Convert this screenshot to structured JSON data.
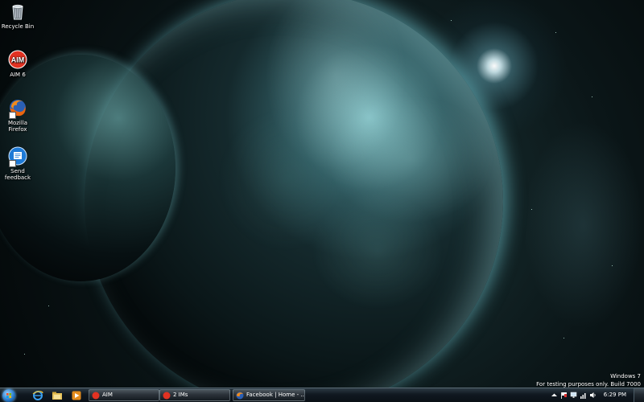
{
  "desktop": {
    "icons": [
      {
        "label": "Recycle Bin",
        "icon": "recycle-bin-icon"
      },
      {
        "label": "AIM 6",
        "icon": "aim-icon"
      },
      {
        "label": "Mozilla Firefox",
        "icon": "firefox-icon"
      },
      {
        "label": "Send feedback",
        "icon": "feedback-icon"
      }
    ],
    "watermark": {
      "line1": "Windows 7",
      "line2": "For testing purposes only. Build 7000"
    }
  },
  "taskbar": {
    "start_icon": "windows-start-orb-icon",
    "quick_launch": [
      {
        "icon": "internet-explorer-icon"
      },
      {
        "icon": "windows-explorer-icon"
      },
      {
        "icon": "media-player-icon"
      }
    ],
    "buttons": [
      {
        "label": "AIM",
        "icon": "aim-icon"
      },
      {
        "label": "2 IMs",
        "icon": "aim-icon"
      },
      {
        "label": "Facebook | Home - ...",
        "icon": "firefox-icon"
      }
    ],
    "tray": {
      "icons": [
        "show-hidden-icons-arrow-icon",
        "action-center-flag-icon",
        "network-icon",
        "signal-icon",
        "volume-icon"
      ],
      "time": "6:29 PM"
    }
  },
  "colors": {
    "taskbar": "#101820",
    "accent_glow": "#7fc8ff",
    "planet_highlight": "#96dce1"
  }
}
